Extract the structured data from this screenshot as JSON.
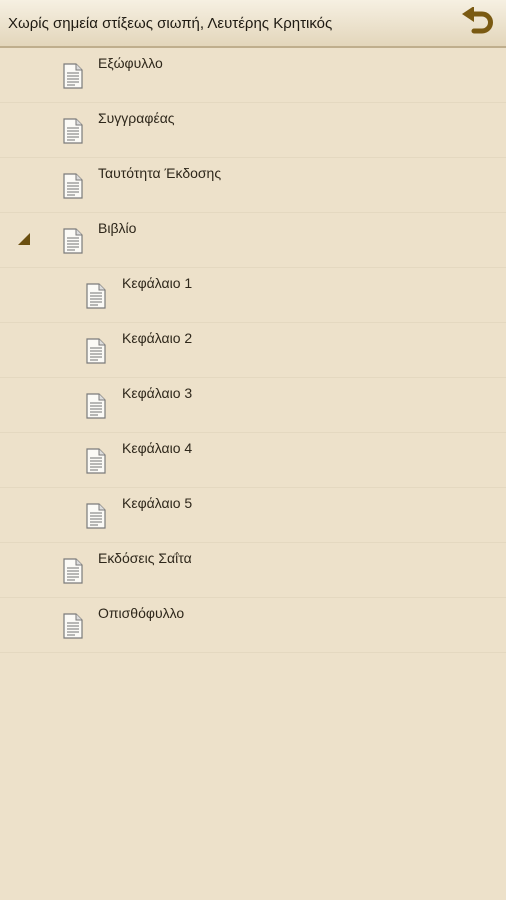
{
  "header": {
    "title": "Χωρίς σημεία στίξεως σιωπή, Λευτέρης Κρητικός",
    "back_icon": "undo-arrow-icon"
  },
  "colors": {
    "background": "#ede1ca",
    "accent": "#7a5a12"
  },
  "toc": {
    "items": [
      {
        "label": "Εξώφυλλο",
        "level": 0
      },
      {
        "label": "Συγγραφέας",
        "level": 0
      },
      {
        "label": "Ταυτότητα Έκδοσης",
        "level": 0
      },
      {
        "label": "Βιβλίο",
        "level": 0,
        "expanded": true
      },
      {
        "label": "Κεφάλαιο 1",
        "level": 1
      },
      {
        "label": "Κεφάλαιο 2",
        "level": 1
      },
      {
        "label": "Κεφάλαιο 3",
        "level": 1
      },
      {
        "label": "Κεφάλαιο 4",
        "level": 1
      },
      {
        "label": "Κεφάλαιο 5",
        "level": 1
      },
      {
        "label": "Εκδόσεις Σαΐτα",
        "level": 0
      },
      {
        "label": "Οπισθόφυλλο",
        "level": 0
      }
    ]
  }
}
